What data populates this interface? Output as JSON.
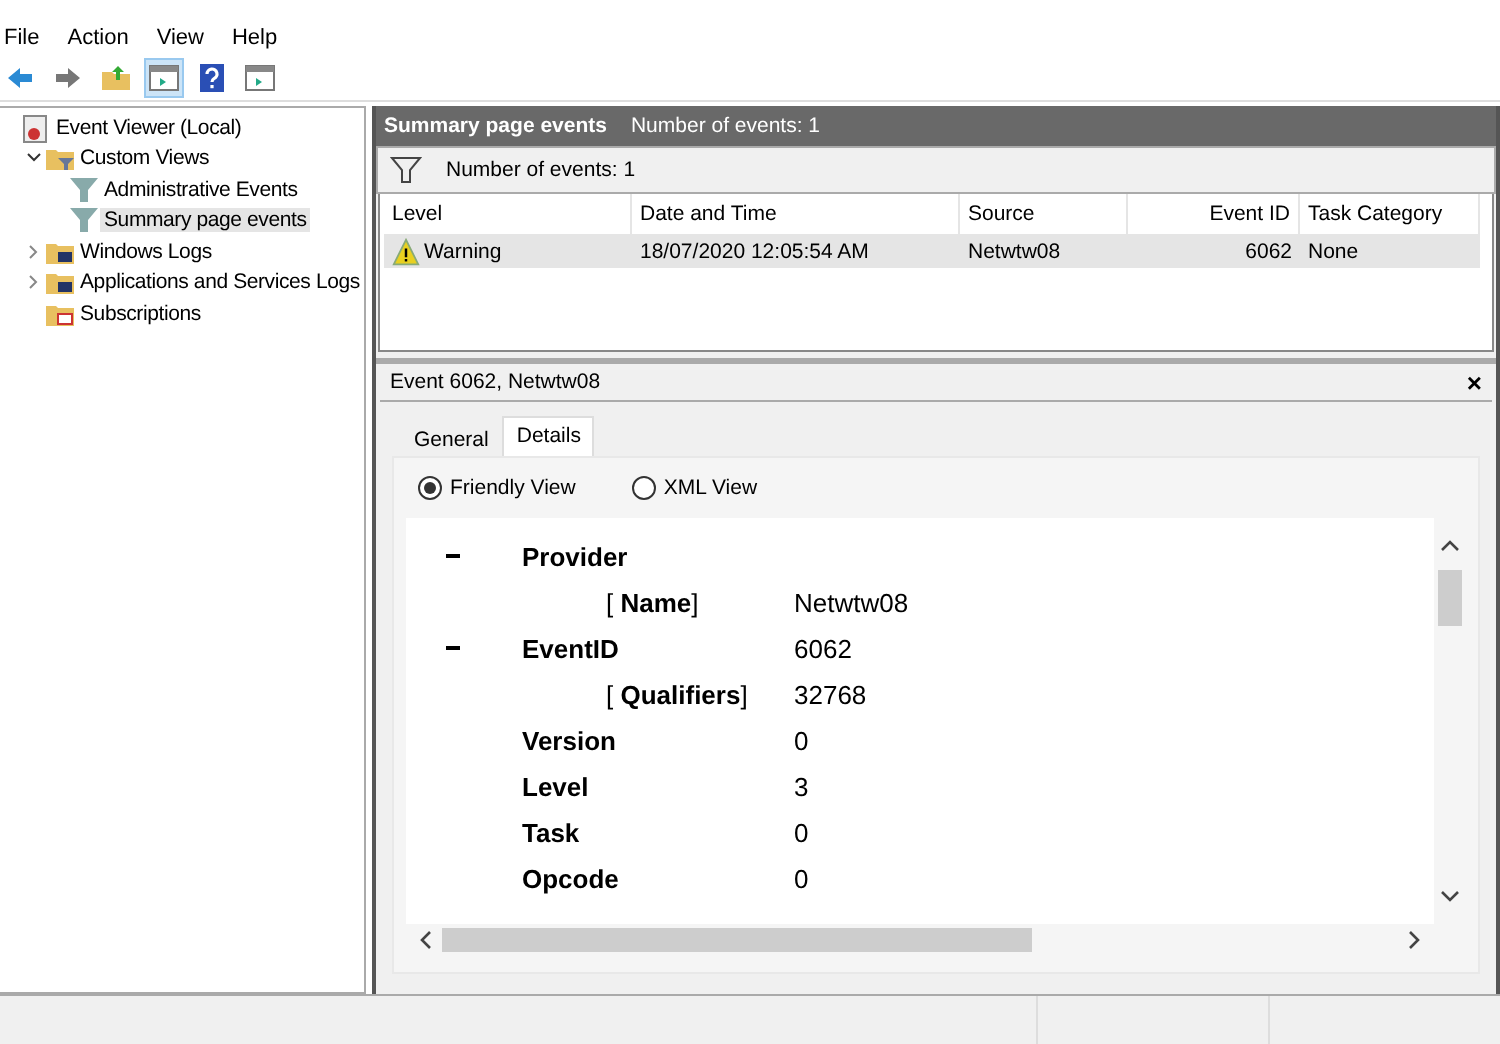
{
  "menu": [
    "File",
    "Action",
    "View",
    "Help"
  ],
  "toolbar": [
    {
      "kind": "back",
      "selected": false
    },
    {
      "kind": "forward",
      "selected": false
    },
    {
      "kind": "up-folder",
      "selected": false
    },
    {
      "kind": "pane",
      "selected": true
    },
    {
      "kind": "help",
      "selected": false
    },
    {
      "kind": "pane",
      "selected": false
    }
  ],
  "tree": [
    {
      "label": "Event Viewer (Local)",
      "kind": "root",
      "selected": false,
      "children": [
        {
          "label": "Custom Views",
          "kind": "views",
          "expanded": true,
          "selected": false,
          "children": [
            {
              "label": "Administrative Events",
              "kind": "view",
              "selected": false
            },
            {
              "label": "Summary page events",
              "kind": "view",
              "selected": true
            }
          ]
        },
        {
          "label": "Windows Logs",
          "kind": "logs",
          "expanded": false,
          "selected": false
        },
        {
          "label": "Applications and Services Logs",
          "kind": "logs",
          "expanded": false,
          "selected": false
        },
        {
          "label": "Subscriptions",
          "kind": "subscriptions",
          "selected": false
        }
      ]
    }
  ],
  "header": {
    "title": "Summary page events",
    "subtitle": "Number of events: 1"
  },
  "filter_bar": {
    "label": "Number of events: 1"
  },
  "table": {
    "columns": [
      "Level",
      "Date and Time",
      "Source",
      "Event ID",
      "Task Category"
    ],
    "rows": [
      {
        "selected": true,
        "cells": [
          "Warning",
          "18/07/2020 12:05:54 AM",
          "Netwtw08",
          "6062",
          "None"
        ]
      }
    ]
  },
  "detail": {
    "title": "Event 6062, Netwtw08",
    "close": "×",
    "tabs": [
      {
        "label": "General",
        "selected": false
      },
      {
        "label": "Details",
        "selected": true
      }
    ],
    "views": [
      {
        "label": "Friendly View",
        "selected": true
      },
      {
        "label": "XML View",
        "selected": false
      }
    ],
    "fields": [
      {
        "kind": "element",
        "collapsible": true,
        "label": "Provider"
      },
      {
        "kind": "attribute",
        "label": "[ **Name**]",
        "value": "Netwtw08"
      },
      {
        "kind": "element",
        "collapsible": true,
        "label": "EventID",
        "value": "6062"
      },
      {
        "kind": "attribute",
        "label": "[ **Qualifiers**]",
        "value": "32768"
      },
      {
        "kind": "element",
        "collapsible": false,
        "label": "Version",
        "value": "0"
      },
      {
        "kind": "element",
        "collapsible": false,
        "label": "Level",
        "value": "3"
      },
      {
        "kind": "element",
        "collapsible": false,
        "label": "Task",
        "value": "0"
      },
      {
        "kind": "element",
        "collapsible": false,
        "label": "Opcode",
        "value": "0"
      }
    ]
  }
}
